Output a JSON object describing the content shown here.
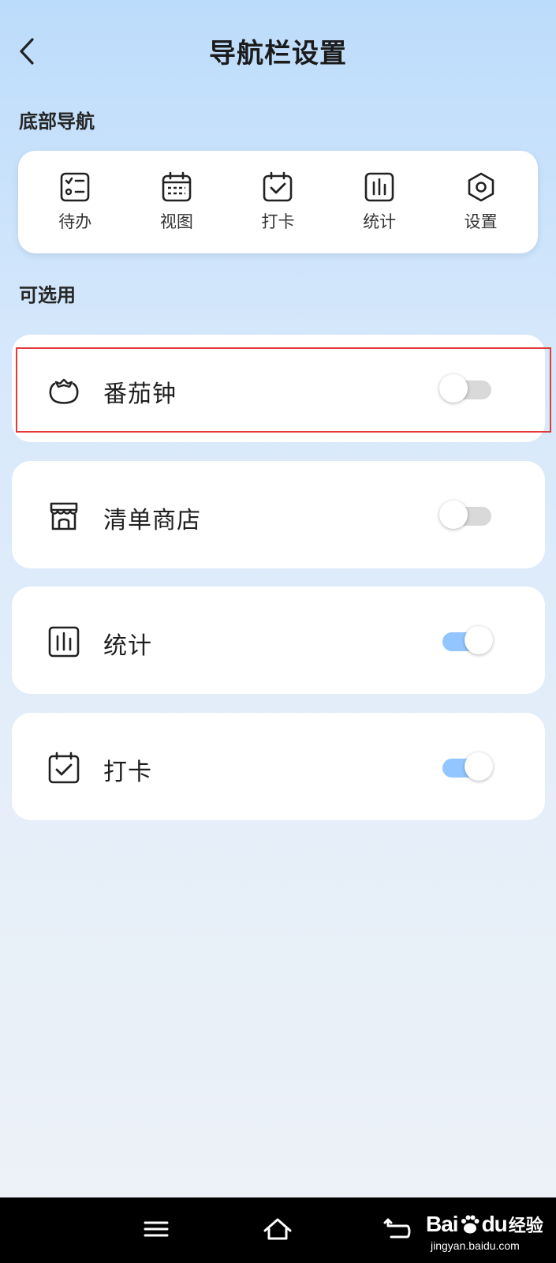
{
  "header": {
    "title": "导航栏设置"
  },
  "sections": {
    "bottom_nav": "底部导航",
    "available": "可选用"
  },
  "bottom_nav_items": [
    {
      "label": "待办",
      "icon": "todo-list-icon"
    },
    {
      "label": "视图",
      "icon": "calendar-grid-icon"
    },
    {
      "label": "打卡",
      "icon": "checkin-calendar-icon"
    },
    {
      "label": "统计",
      "icon": "statistics-chart-icon"
    },
    {
      "label": "设置",
      "icon": "hexagon-settings-icon"
    }
  ],
  "options": [
    {
      "label": "番茄钟",
      "icon": "tomato-icon",
      "enabled": false,
      "highlighted": true
    },
    {
      "label": "清单商店",
      "icon": "store-icon",
      "enabled": false
    },
    {
      "label": "统计",
      "icon": "statistics-chart-icon",
      "enabled": true
    },
    {
      "label": "打卡",
      "icon": "checkin-calendar-icon",
      "enabled": true
    }
  ],
  "colors": {
    "toggle_on": "#93c6ff",
    "toggle_off": "#d9d9d9",
    "highlight": "#e23a3a",
    "background_top": "#bcdcfb"
  },
  "watermark": {
    "brand_left": "Bai",
    "brand_right": "du",
    "product": "经验",
    "url": "jingyan.baidu.com"
  }
}
